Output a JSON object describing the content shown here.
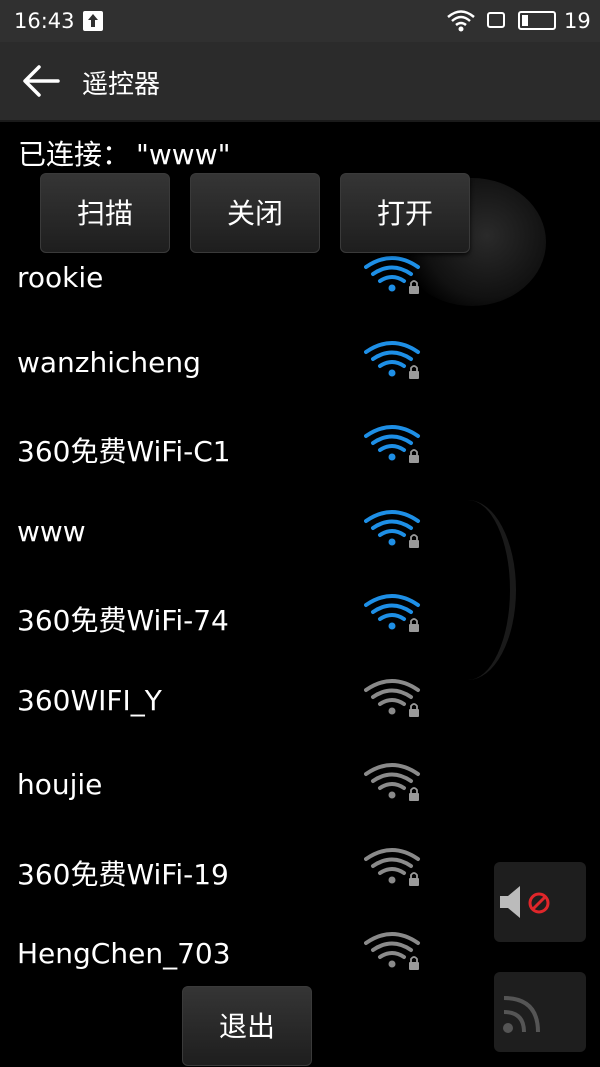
{
  "status_bar": {
    "time": "16:43",
    "battery": "19",
    "icons": [
      "upload-icon",
      "wifi-icon",
      "sim-icon",
      "battery-icon"
    ]
  },
  "toolbar": {
    "title": "遥控器",
    "back_icon": "arrow-left-icon"
  },
  "connection": {
    "label": "已连接：",
    "ssid": "\"www\""
  },
  "actions": {
    "scan": "扫描",
    "close": "关闭",
    "open": "打开"
  },
  "wifi_list": [
    {
      "name": "rookie",
      "signal_color": "#1e8fe6"
    },
    {
      "name": "wanzhicheng",
      "signal_color": "#1e8fe6"
    },
    {
      "name": "360免费WiFi-C1",
      "signal_color": "#1e8fe6"
    },
    {
      "name": "www",
      "signal_color": "#1e8fe6"
    },
    {
      "name": "360免费WiFi-74",
      "signal_color": "#1e8fe6"
    },
    {
      "name": "360WIFI_Y",
      "signal_color": "#8a8a8a"
    },
    {
      "name": "houjie",
      "signal_color": "#8a8a8a"
    },
    {
      "name": "360免费WiFi-19",
      "signal_color": "#8a8a8a"
    },
    {
      "name": "HengChen_703",
      "signal_color": "#8a8a8a"
    }
  ],
  "exit": "退出",
  "colors": {
    "accent_blue": "#1e8fe6",
    "inactive_gray": "#8a8a8a",
    "mute_red": "#e0262a"
  }
}
